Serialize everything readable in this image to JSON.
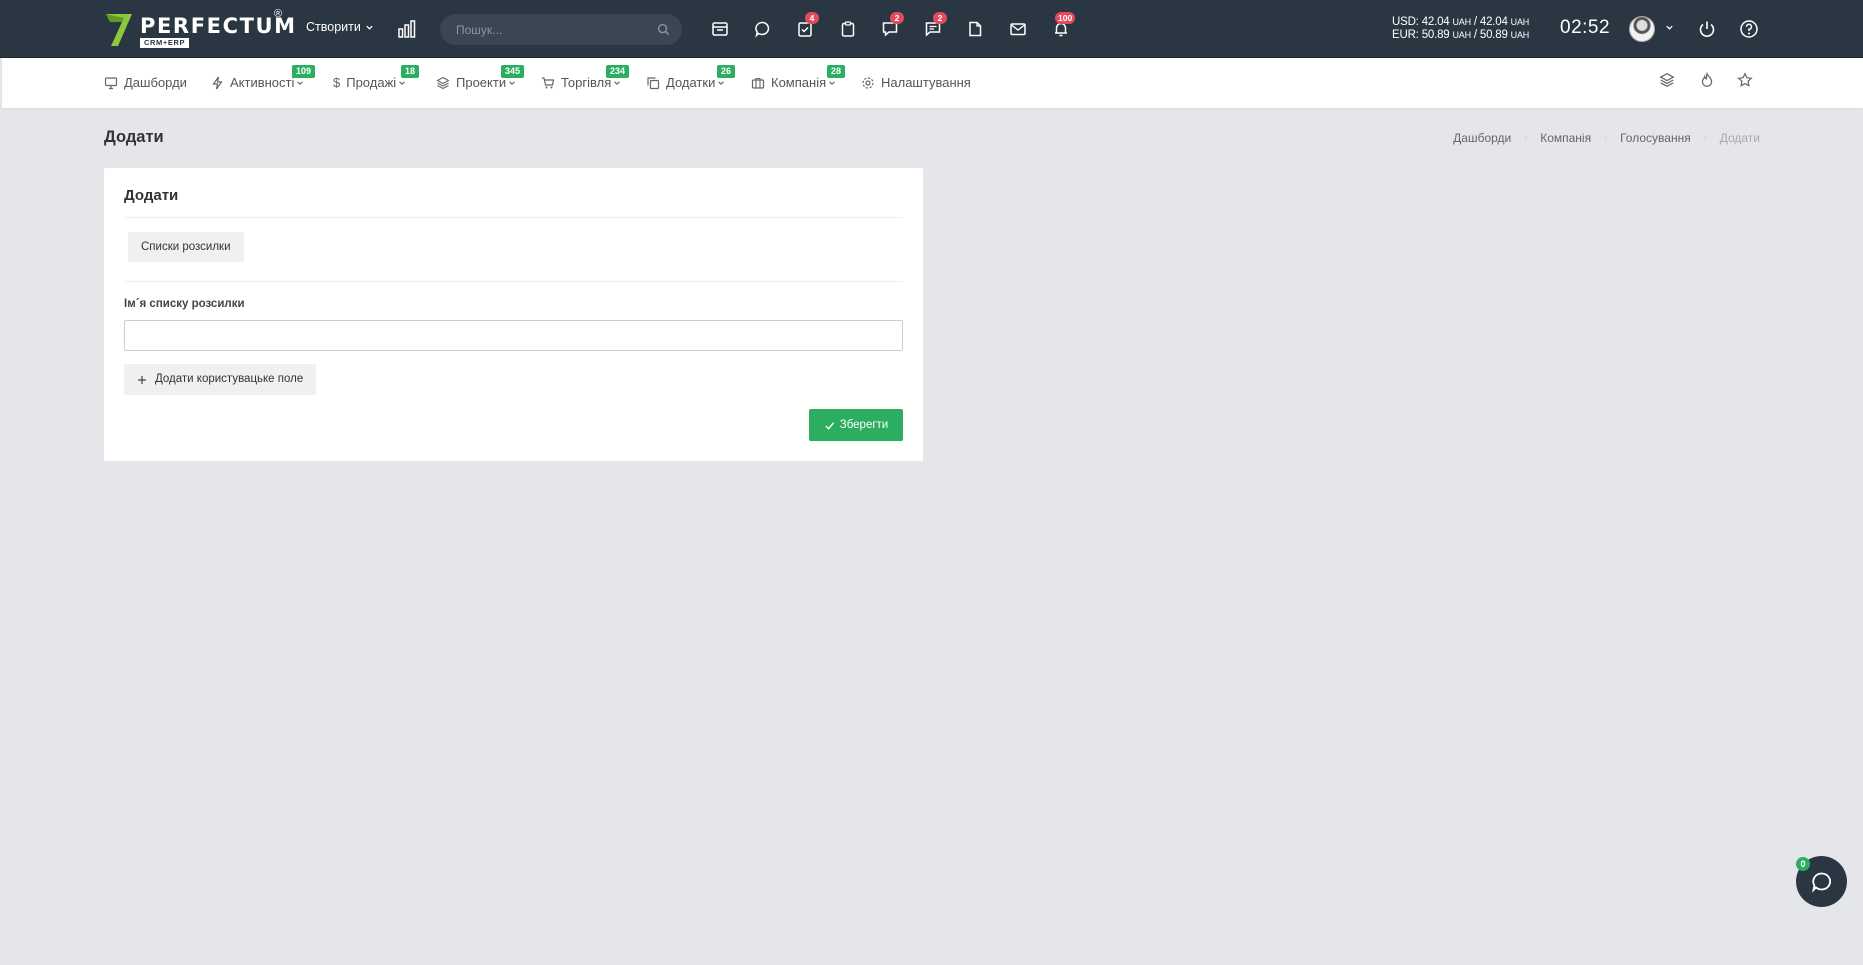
{
  "brand": {
    "name": "PERFECTUM",
    "subtitle": "CRM+ERP",
    "registered": "®",
    "accent": "#8dc63f"
  },
  "topbar": {
    "create_label": "Створити",
    "search_placeholder": "Пошук...",
    "icons": [
      {
        "name": "calendar-icon",
        "badge": ""
      },
      {
        "name": "chat-bubble-icon",
        "badge": ""
      },
      {
        "name": "tasks-icon",
        "badge": "4"
      },
      {
        "name": "clipboard-icon",
        "badge": ""
      },
      {
        "name": "messages-icon",
        "badge": "2"
      },
      {
        "name": "comments-icon",
        "badge": "2"
      },
      {
        "name": "document-icon",
        "badge": ""
      },
      {
        "name": "mail-icon",
        "badge": ""
      },
      {
        "name": "notifications-icon",
        "badge": "100"
      }
    ],
    "currency": {
      "usd_label": "USD:",
      "usd_buy": "42.04",
      "usd_sell": "42.04",
      "eur_label": "EUR:",
      "eur_buy": "50.89",
      "eur_sell": "50.89",
      "unit": "UAH"
    },
    "clock": "02:52",
    "colors": {
      "bar": "#2b3643",
      "badge": "#e24b5d"
    }
  },
  "menu": {
    "items": [
      {
        "label": "Дашборди",
        "badge": ""
      },
      {
        "label": "Активності",
        "badge": "109"
      },
      {
        "label": "Продажі",
        "badge": "18"
      },
      {
        "label": "Проекти",
        "badge": "345"
      },
      {
        "label": "Торгівля",
        "badge": "234"
      },
      {
        "label": "Додатки",
        "badge": "26"
      },
      {
        "label": "Компанія",
        "badge": "28"
      },
      {
        "label": "Налаштування",
        "badge": ""
      }
    ],
    "badge_color": "#2bae5f"
  },
  "page": {
    "title": "Додати",
    "breadcrumb": [
      "Дашборди",
      "Компанія",
      "Голосування",
      "Додати"
    ]
  },
  "form": {
    "card_title": "Додати",
    "tag_label": "Списки розсилки",
    "field_label": "Ім´я списку розсилки",
    "field_value": "",
    "add_field_label": "Додати користувацьке поле",
    "save_label": "Зберегти",
    "save_color": "#2bae5f"
  },
  "chat": {
    "badge": "0"
  }
}
